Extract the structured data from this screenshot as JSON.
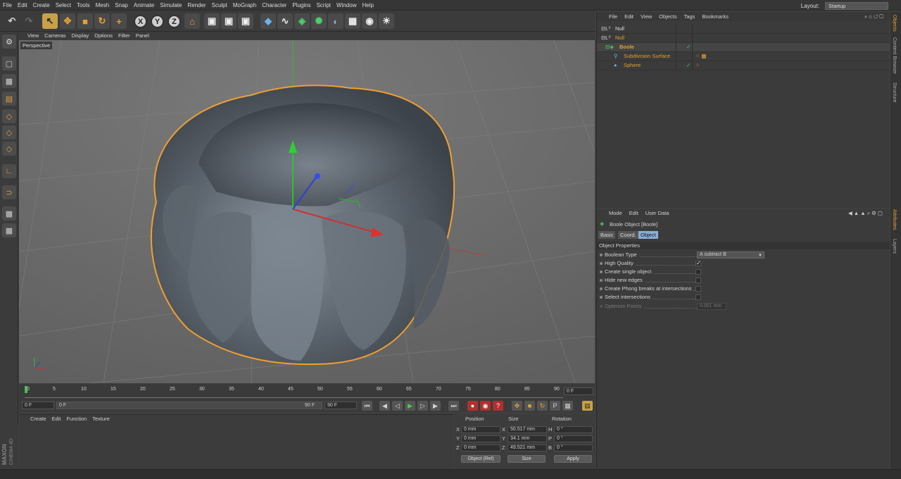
{
  "menubar": {
    "items": [
      "File",
      "Edit",
      "Create",
      "Select",
      "Tools",
      "Mesh",
      "Snap",
      "Animate",
      "Simulate",
      "Render",
      "Sculpt",
      "MoGraph",
      "Character",
      "Plugins",
      "Script",
      "Window",
      "Help"
    ],
    "layout_label": "Layout:",
    "layout_value": "Startup"
  },
  "toolbar": {
    "axis_x": "X",
    "axis_y": "Y",
    "axis_z": "Z"
  },
  "viewport": {
    "menu": [
      "View",
      "Cameras",
      "Display",
      "Options",
      "Filter",
      "Panel"
    ],
    "label": "Perspective"
  },
  "timeline": {
    "ticks": [
      "0",
      "5",
      "10",
      "15",
      "20",
      "25",
      "30",
      "35",
      "40",
      "45",
      "50",
      "55",
      "60",
      "65",
      "70",
      "75",
      "80",
      "85",
      "90"
    ],
    "end_frame": "0 F",
    "start_field": "0 F",
    "range_start": "0 F",
    "range_end": "90 F",
    "end_field": "90 F"
  },
  "material": {
    "menu": [
      "Create",
      "Edit",
      "Function",
      "Texture"
    ]
  },
  "coords": {
    "h_position": "Position",
    "h_size": "Size",
    "h_rotation": "Rotation",
    "rows": [
      {
        "axis": "X",
        "pos": "0 mm",
        "saxis": "X",
        "size": "50.517 mm",
        "raxis": "H",
        "rot": "0 °"
      },
      {
        "axis": "Y",
        "pos": "0 mm",
        "saxis": "Y",
        "size": "34.1 mm",
        "raxis": "P",
        "rot": "0 °"
      },
      {
        "axis": "Z",
        "pos": "0 mm",
        "saxis": "Z",
        "size": "49.521 mm",
        "raxis": "B",
        "rot": "0 °"
      }
    ],
    "mode": "Object (Rel)",
    "size_mode": "Size",
    "apply": "Apply"
  },
  "brand": {
    "maxon": "MAXON",
    "product": "CINEMA 4D"
  },
  "objects": {
    "menu": [
      "File",
      "Edit",
      "View",
      "Objects",
      "Tags",
      "Bookmarks"
    ],
    "rows": [
      {
        "name": "Null",
        "color": "#e0e0e0"
      },
      {
        "name": "Null",
        "color": "#e0a030"
      },
      {
        "name": "Boole",
        "color": "#e0a030"
      },
      {
        "name": "Subdivision Surface",
        "color": "#e0a030"
      },
      {
        "name": "Sphere",
        "color": "#e0a030"
      }
    ]
  },
  "attributes": {
    "menu": [
      "Mode",
      "Edit",
      "User Data"
    ],
    "title": "Boole Object [Boole]",
    "tabs": [
      "Basic",
      "Coord.",
      "Object"
    ],
    "section": "Object Properties",
    "props": [
      {
        "label": "Boolean Type",
        "value": "A subtract B"
      },
      {
        "label": "High Quality",
        "checked": true
      },
      {
        "label": "Create single object"
      },
      {
        "label": "Hide new edges"
      },
      {
        "label": "Create Phong breaks at intersections"
      },
      {
        "label": "Select intersections"
      },
      {
        "label": "Optimize Points",
        "value": "0.001 mm"
      }
    ]
  },
  "right_tabs": [
    "Objects",
    "Content Browser",
    "Structure",
    "Attributes",
    "Layers"
  ]
}
